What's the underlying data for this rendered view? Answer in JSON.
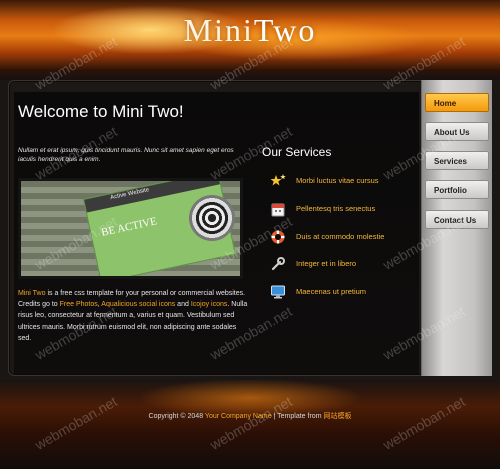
{
  "header": {
    "logo_part1": "Mini",
    "logo_part2": "Two"
  },
  "nav": {
    "items": [
      {
        "label": "Home",
        "active": true
      },
      {
        "label": "About Us",
        "active": false
      },
      {
        "label": "Services",
        "active": false
      },
      {
        "label": "Portfolio",
        "active": false
      },
      {
        "label": "Contact Us",
        "active": false
      }
    ]
  },
  "main": {
    "welcome_title": "Welcome to Mini Two!",
    "intro_text": "Nullam et erat ipsum, quis tincidunt mauris. Nunc sit amet sapien eget eros iaculis hendrerit quis a enim.",
    "screenshot": {
      "card_title": "Active Website",
      "card_heading": "BE ACTIVE"
    },
    "description": {
      "part1": "Mini Two",
      "part2": " is a free css template for your personal or commercial websites. Credits go to ",
      "part3": "Free Photos",
      "part4": ", ",
      "part5": "Aqualicious social icons",
      "part6": " and ",
      "part7": "Icojoy icons",
      "part8": ". Nulla risus leo, consectetur at fermentum a, varius et quam. Vestibulum sed ultrices mauris. Morbi rutrum euismod elit, non adipiscing ante sodales sed."
    }
  },
  "services": {
    "title": "Our Services",
    "items": [
      {
        "label": "Morbi luctus vitae cursus",
        "icon": "stars-icon"
      },
      {
        "label": "Pellentesq tris senectus",
        "icon": "calendar-icon"
      },
      {
        "label": "Duis at commodo molestie",
        "icon": "lifebuoy-icon"
      },
      {
        "label": "Integer et in libero",
        "icon": "wrench-icon"
      },
      {
        "label": "Maecenas ut pretium",
        "icon": "monitor-icon"
      }
    ]
  },
  "footer": {
    "copyright_prefix": "Copyright © 2048 ",
    "company": "Your Company Name",
    "separator": " | Template from ",
    "template_source": "网站模板"
  },
  "watermark_text": "webmoban.net",
  "colors": {
    "accent": "#f5a623",
    "nav_active": "#f39a0e",
    "background": "#1a1614"
  }
}
